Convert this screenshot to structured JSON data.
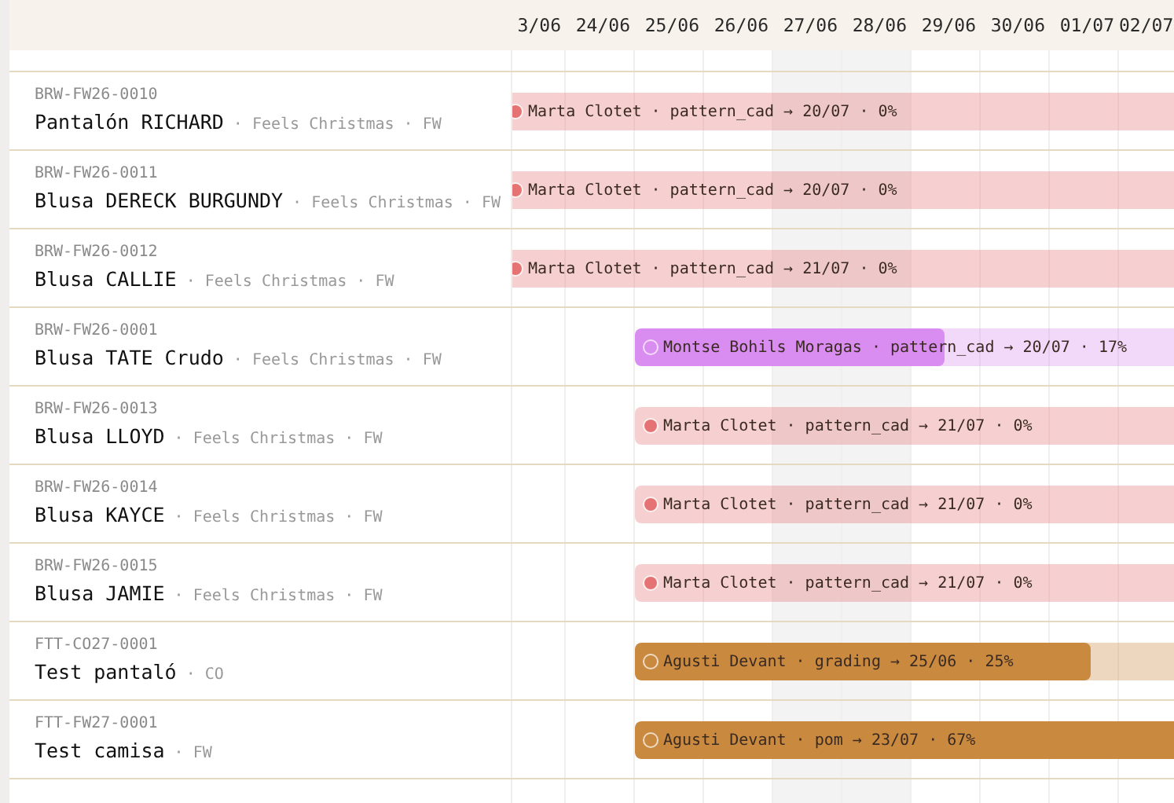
{
  "days": [
    {
      "label": "3/06",
      "weekend": false
    },
    {
      "label": "24/06",
      "weekend": false
    },
    {
      "label": "25/06",
      "weekend": false
    },
    {
      "label": "26/06",
      "weekend": false
    },
    {
      "label": "27/06",
      "weekend": true
    },
    {
      "label": "28/06",
      "weekend": true
    },
    {
      "label": "29/06",
      "weekend": false
    },
    {
      "label": "30/06",
      "weekend": false
    },
    {
      "label": "01/07",
      "weekend": false
    },
    {
      "label": "02/07",
      "weekend": false
    }
  ],
  "rows": [
    {
      "code": "BRW-FW26-0010",
      "title": "Pantalón RICHARD",
      "meta": "· Feels Christmas · FW",
      "bar": {
        "clipped_left": true,
        "label": "Marta Clotet · pattern_cad → 20/07 · 0%",
        "color": "#e57373",
        "level": 0
      }
    },
    {
      "code": "BRW-FW26-0011",
      "title": "Blusa DERECK BURGUNDY",
      "meta": "· Feels Christmas · FW",
      "bar": {
        "clipped_left": true,
        "label": "Marta Clotet · pattern_cad → 20/07 · 0%",
        "color": "#e57373",
        "level": 0
      }
    },
    {
      "code": "BRW-FW26-0012",
      "title": "Blusa CALLIE",
      "meta": "· Feels Christmas · FW",
      "bar": {
        "clipped_left": true,
        "label": "Marta Clotet · pattern_cad → 21/07 · 0%",
        "color": "#e57373",
        "level": 0
      }
    },
    {
      "code": "BRW-FW26-0001",
      "title": "Blusa TATE Crudo",
      "meta": "· Feels Christmas · FW",
      "bar": {
        "clipped_left": false,
        "label": "Montse Bohils Moragas · pattern_cad → 20/07 · 17%",
        "color": "#d98df0",
        "level": 0.17
      }
    },
    {
      "code": "BRW-FW26-0013",
      "title": "Blusa LLOYD",
      "meta": "· Feels Christmas · FW",
      "bar": {
        "clipped_left": false,
        "label": "Marta Clotet · pattern_cad → 21/07 · 0%",
        "color": "#e57373",
        "level": 0
      }
    },
    {
      "code": "BRW-FW26-0014",
      "title": "Blusa KAYCE",
      "meta": "· Feels Christmas · FW",
      "bar": {
        "clipped_left": false,
        "label": "Marta Clotet · pattern_cad → 21/07 · 0%",
        "color": "#e57373",
        "level": 0
      }
    },
    {
      "code": "BRW-FW26-0015",
      "title": "Blusa JAMIE",
      "meta": "· Feels Christmas · FW",
      "bar": {
        "clipped_left": false,
        "label": "Marta Clotet · pattern_cad → 21/07 · 0%",
        "color": "#e57373",
        "level": 0
      }
    },
    {
      "code": "FTT-CO27-0001",
      "title": "Test pantaló",
      "meta": "· CO",
      "bar": {
        "clipped_left": false,
        "label": "Agusti Devant · grading → 25/06 · 25%",
        "color": "#c98a40",
        "level": 0.25
      }
    },
    {
      "code": "FTT-FW27-0001",
      "title": "Test camisa",
      "meta": "· FW",
      "bar": {
        "clipped_left": false,
        "label": "Agusti Devant · pom → 23/07 · 67%",
        "color": "#c98a40",
        "level": 0.67
      }
    }
  ]
}
